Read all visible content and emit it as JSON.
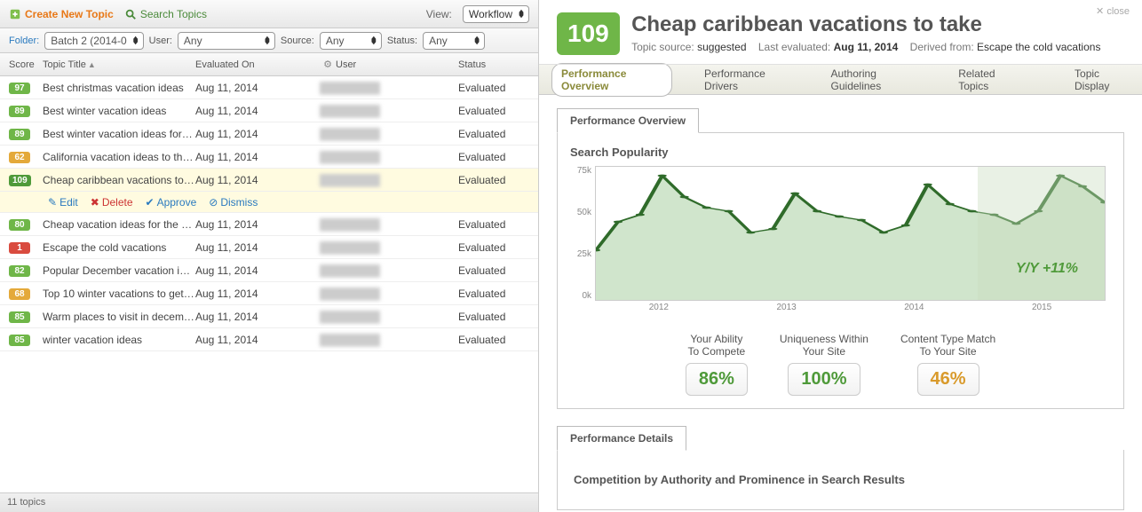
{
  "toolbar": {
    "create_label": "Create New Topic",
    "search_label": "Search Topics",
    "view_label": "View:",
    "view_value": "Workflow"
  },
  "filters": {
    "folder_label": "Folder:",
    "folder_value": "Batch 2 (2014-0",
    "user_label": "User:",
    "user_value": "Any",
    "source_label": "Source:",
    "source_value": "Any",
    "status_label": "Status:",
    "status_value": "Any"
  },
  "columns": {
    "score": "Score",
    "title": "Topic Title",
    "evaluated": "Evaluated On",
    "user": "User",
    "status": "Status"
  },
  "rows": [
    {
      "score": "97",
      "score_cls": "sb-green",
      "title": "Best christmas vacation ideas",
      "date": "Aug 11, 2014",
      "status": "Evaluated"
    },
    {
      "score": "89",
      "score_cls": "sb-green",
      "title": "Best winter vacation ideas",
      "date": "Aug 11, 2014",
      "status": "Evaluated"
    },
    {
      "score": "89",
      "score_cls": "sb-green",
      "title": "Best winter vacation ideas for …",
      "date": "Aug 11, 2014",
      "status": "Evaluated"
    },
    {
      "score": "62",
      "score_cls": "sb-orange",
      "title": "California vacation ideas to thi…",
      "date": "Aug 11, 2014",
      "status": "Evaluated"
    },
    {
      "score": "109",
      "score_cls": "sb-dgreen",
      "title": "Cheap caribbean vacations to …",
      "date": "Aug 11, 2014",
      "status": "Evaluated",
      "selected": true
    },
    {
      "score": "80",
      "score_cls": "sb-green",
      "title": "Cheap vacation ideas for the …",
      "date": "Aug 11, 2014",
      "status": "Evaluated"
    },
    {
      "score": "1",
      "score_cls": "sb-red",
      "title": "Escape the cold vacations",
      "date": "Aug 11, 2014",
      "status": "Evaluated"
    },
    {
      "score": "82",
      "score_cls": "sb-green",
      "title": "Popular December vacation id…",
      "date": "Aug 11, 2014",
      "status": "Evaluated"
    },
    {
      "score": "68",
      "score_cls": "sb-orange",
      "title": "Top 10 winter vacations to get …",
      "date": "Aug 11, 2014",
      "status": "Evaluated"
    },
    {
      "score": "85",
      "score_cls": "sb-green",
      "title": "Warm places to visit in decem…",
      "date": "Aug 11, 2014",
      "status": "Evaluated"
    },
    {
      "score": "85",
      "score_cls": "sb-green",
      "title": "winter vacation ideas",
      "date": "Aug 11, 2014",
      "status": "Evaluated"
    }
  ],
  "row_actions": {
    "edit": "Edit",
    "delete": "Delete",
    "approve": "Approve",
    "dismiss": "Dismiss"
  },
  "status_bar": "11 topics",
  "detail": {
    "score": "109",
    "title": "Cheap caribbean vacations to take",
    "source_label": "Topic source:",
    "source_value": "suggested",
    "eval_label": "Last evaluated:",
    "eval_value": "Aug 11, 2014",
    "derived_label": "Derived from:",
    "derived_value": "Escape the cold vacations",
    "close": "close"
  },
  "tabs": {
    "overview": "Performance Overview",
    "drivers": "Performance Drivers",
    "guidelines": "Authoring Guidelines",
    "related": "Related Topics",
    "display": "Topic Display"
  },
  "sub_tabs": {
    "overview": "Performance Overview",
    "details": "Performance Details"
  },
  "chart": {
    "title": "Search Popularity",
    "y_ticks": [
      "75k",
      "50k",
      "25k",
      "0k"
    ],
    "x_ticks": [
      "2012",
      "2013",
      "2014",
      "2015"
    ],
    "yy_label": "Y/Y +11%"
  },
  "metrics": [
    {
      "label1": "Your Ability",
      "label2": "To Compete",
      "value": "86%",
      "cls": "mv-green"
    },
    {
      "label1": "Uniqueness Within",
      "label2": "Your Site",
      "value": "100%",
      "cls": "mv-green"
    },
    {
      "label1": "Content Type Match",
      "label2": "To Your Site",
      "value": "46%",
      "cls": "mv-orange"
    }
  ],
  "competition_title": "Competition by Authority and Prominence in Search Results",
  "chart_data": {
    "type": "area",
    "title": "Search Popularity",
    "xlabel": "",
    "ylabel": "",
    "ylim": [
      0,
      75000
    ],
    "x_range": [
      "2011-07",
      "2015-06"
    ],
    "yy_change": "+11%",
    "series": [
      {
        "name": "Search Popularity",
        "x": [
          "2011-07",
          "2011-09",
          "2011-11",
          "2012-01",
          "2012-03",
          "2012-05",
          "2012-07",
          "2012-09",
          "2012-11",
          "2013-01",
          "2013-03",
          "2013-05",
          "2013-07",
          "2013-09",
          "2013-11",
          "2014-01",
          "2014-03",
          "2014-05",
          "2014-07",
          "2014-09",
          "2014-11",
          "2015-01",
          "2015-03",
          "2015-05"
        ],
        "values": [
          28000,
          44000,
          48000,
          70000,
          58000,
          52000,
          50000,
          38000,
          40000,
          60000,
          50000,
          47000,
          45000,
          38000,
          42000,
          65000,
          54000,
          50000,
          48000,
          43000,
          50000,
          70000,
          64000,
          55000
        ]
      }
    ]
  }
}
